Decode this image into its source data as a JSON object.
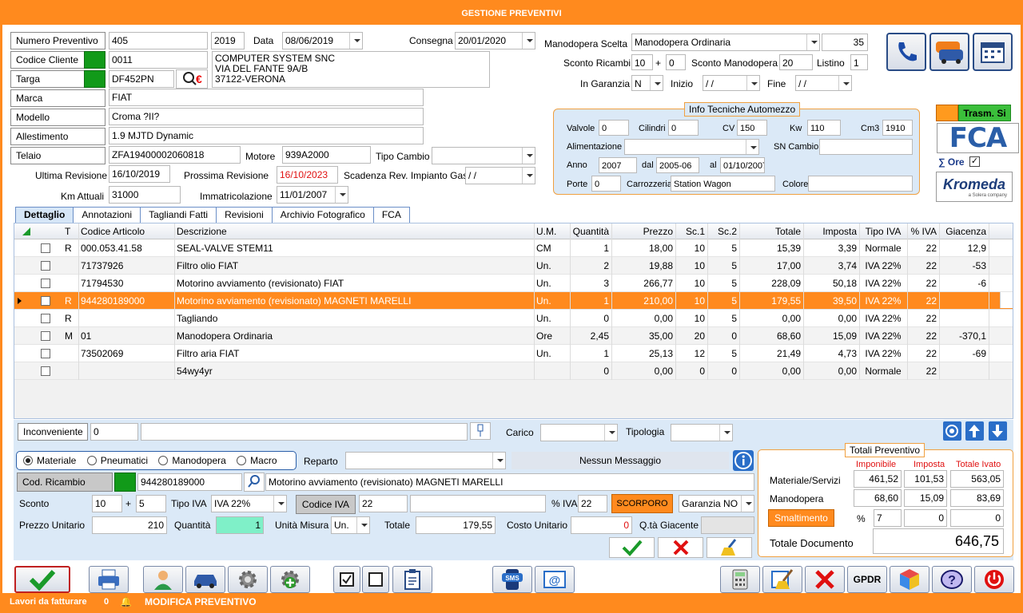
{
  "title": "GESTIONE PREVENTIVI",
  "header": {
    "numero_label": "Numero Preventivo",
    "numero": "405",
    "anno": "2019",
    "data_label": "Data",
    "data": "08/06/2019",
    "consegna_label": "Consegna",
    "consegna": "20/01/2020",
    "codice_cliente_label": "Codice Cliente",
    "codice_cliente": "0011",
    "cliente_addr": [
      "COMPUTER SYSTEM SNC",
      "VIA DEL FANTE 9A/B",
      "37122-VERONA"
    ],
    "targa_label": "Targa",
    "targa": "DF452PN",
    "marca_label": "Marca",
    "marca": "FIAT",
    "modello_label": "Modello",
    "modello": "Croma ?II?",
    "allestimento_label": "Allestimento",
    "allestimento": "1.9 MJTD Dynamic",
    "telaio_label": "Telaio",
    "telaio": "ZFA19400002060818",
    "motore_label": "Motore",
    "motore": "939A2000",
    "tipo_cambio_label": "Tipo Cambio",
    "tipo_cambio": "",
    "ultima_rev_label": "Ultima Revisione",
    "ultima_rev": "16/10/2019",
    "prossima_rev_label": "Prossima Revisione",
    "prossima_rev": "16/10/2023",
    "scad_gas_label": "Scadenza Rev. Impianto Gas",
    "scad_gas": " / /",
    "km_label": "Km Attuali",
    "km": "31000",
    "immatricolazione_label": "Immatricolazione",
    "immatricolazione": "11/01/2007",
    "manodopera_label": "Manodopera Scelta",
    "manodopera": "Manodopera Ordinaria",
    "manodopera_val": "35",
    "sconto_ricambi_label": "Sconto Ricambi",
    "sconto_ricambi_1": "10",
    "plus": "+",
    "sconto_ricambi_2": "0",
    "sconto_manodopera_label": "Sconto Manodopera",
    "sconto_manodopera": "20",
    "listino_label": "Listino",
    "listino": "1",
    "garanzia_label": "In Garanzia",
    "garanzia": "N",
    "inizio_label": "Inizio",
    "inizio": " / /",
    "fine_label": "Fine",
    "fine": " / /"
  },
  "info_tecniche": {
    "title": "Info Tecniche Automezzo",
    "valvole_label": "Valvole",
    "valvole": "0",
    "cilindri_label": "Cilindri",
    "cilindri": "0",
    "cv_label": "CV",
    "cv": "150",
    "kw_label": "Kw",
    "kw": "110",
    "cm3_label": "Cm3",
    "cm3": "1910",
    "alimentazione_label": "Alimentazione",
    "alimentazione": "",
    "sn_cambio_label": "SN Cambio",
    "sn_cambio": "",
    "anno_label": "Anno",
    "anno": "2007",
    "dal_label": "dal",
    "dal": "2005-06",
    "al_label": "al",
    "al": "01/10/2007",
    "porte_label": "Porte",
    "porte": "0",
    "carrozzeria_label": "Carrozzeria",
    "carrozzeria": "Station Wagon",
    "colore_label": "Colore",
    "colore": ""
  },
  "side": {
    "trasm": "Trasm. Si",
    "fca": "FCA",
    "ore": "∑ Ore",
    "kromeda": "Kromeda",
    "kromeda_sub": "a Solera company"
  },
  "tabs": [
    "Dettaglio",
    "Annotazioni",
    "Tagliandi Fatti",
    "Revisioni",
    "Archivio Fotografico",
    "FCA"
  ],
  "table": {
    "headers": [
      "T",
      "Codice Articolo",
      "Descrizione",
      "U.M.",
      "Quantità",
      "Prezzo",
      "Sc.1",
      "Sc.2",
      "Totale",
      "Imposta",
      "Tipo IVA",
      "% IVA",
      "Giacenza"
    ],
    "rows": [
      [
        "R",
        "000.053.41.58",
        "SEAL-VALVE STEM11",
        "CM",
        "1",
        "18,00",
        "10",
        "5",
        "15,39",
        "3,39",
        "Normale",
        "22",
        "12,9"
      ],
      [
        "",
        "71737926",
        "Filtro olio FIAT",
        "Un.",
        "2",
        "19,88",
        "10",
        "5",
        "17,00",
        "3,74",
        "IVA 22%",
        "22",
        "-53"
      ],
      [
        "",
        "71794530",
        "Motorino avviamento (revisionato) FIAT",
        "Un.",
        "3",
        "266,77",
        "10",
        "5",
        "228,09",
        "50,18",
        "IVA 22%",
        "22",
        "-6"
      ],
      [
        "R",
        "944280189000",
        "Motorino avviamento (revisionato) MAGNETI MARELLI",
        "Un.",
        "1",
        "210,00",
        "10",
        "5",
        "179,55",
        "39,50",
        "IVA 22%",
        "22",
        ""
      ],
      [
        "R",
        "",
        "Tagliando",
        "Un.",
        "0",
        "0,00",
        "10",
        "5",
        "0,00",
        "0,00",
        "IVA 22%",
        "22",
        ""
      ],
      [
        "M",
        "01",
        "Manodopera Ordinaria",
        "Ore",
        "2,45",
        "35,00",
        "20",
        "0",
        "68,60",
        "15,09",
        "IVA 22%",
        "22",
        "-370,1"
      ],
      [
        "",
        "73502069",
        "Filtro aria FIAT",
        "Un.",
        "1",
        "25,13",
        "12",
        "5",
        "21,49",
        "4,73",
        "IVA 22%",
        "22",
        "-69"
      ],
      [
        "",
        "",
        "54wy4yr",
        "",
        "0",
        "0,00",
        "0",
        "0",
        "0,00",
        "0,00",
        "Normale",
        "22",
        ""
      ]
    ]
  },
  "detail": {
    "inconveniente_label": "Inconveniente",
    "inconveniente": "0",
    "carico_label": "Carico",
    "tipologia_label": "Tipologia",
    "radio": [
      "Materiale",
      "Pneumatici",
      "Manodopera",
      "Macro"
    ],
    "reparto_label": "Reparto",
    "messaggio": "Nessun Messaggio",
    "cod_ricambio_label": "Cod. Ricambio",
    "cod_ricambio": "944280189000",
    "descrizione": "Motorino avviamento (revisionato) MAGNETI MARELLI",
    "sconto_label": "Sconto",
    "sconto1": "10",
    "plus": "+",
    "sconto2": "5",
    "tipo_iva_label": "Tipo IVA",
    "tipo_iva": "IVA 22%",
    "codice_iva_label": "Codice IVA",
    "codice_iva": "22",
    "perc_iva_label": "% IVA",
    "perc_iva": "22",
    "scorporo": "SCORPORO",
    "garanzia": "Garanzia NO",
    "prezzo_label": "Prezzo Unitario",
    "prezzo": "210",
    "quantita_label": "Quantità",
    "quantita": "1",
    "um_label": "Unità Misura",
    "um": "Un.",
    "totale_label": "Totale",
    "totale": "179,55",
    "costo_label": "Costo Unitario",
    "costo": "0",
    "giacente_label": "Q.tà Giacente"
  },
  "totali": {
    "title": "Totali Preventivo",
    "imponibile": "Imponibile",
    "imposta": "Imposta",
    "ivato": "Totale Ivato",
    "mat_label": "Materiale/Servizi",
    "mat": [
      "461,52",
      "101,53",
      "563,05"
    ],
    "man_label": "Manodopera",
    "man": [
      "68,60",
      "15,09",
      "83,69"
    ],
    "smalt_label": "Smaltimento",
    "perc": "%",
    "smalt": [
      "7",
      "0",
      "0"
    ],
    "doc_label": "Totale Documento",
    "doc": "646,75"
  },
  "footer": {
    "lavori_label": "Lavori da fatturare",
    "lavori": "0",
    "stato": "MODIFICA PREVENTIVO"
  },
  "toolbar": {
    "gdpr": "GPDR",
    "sms": "SMS"
  }
}
